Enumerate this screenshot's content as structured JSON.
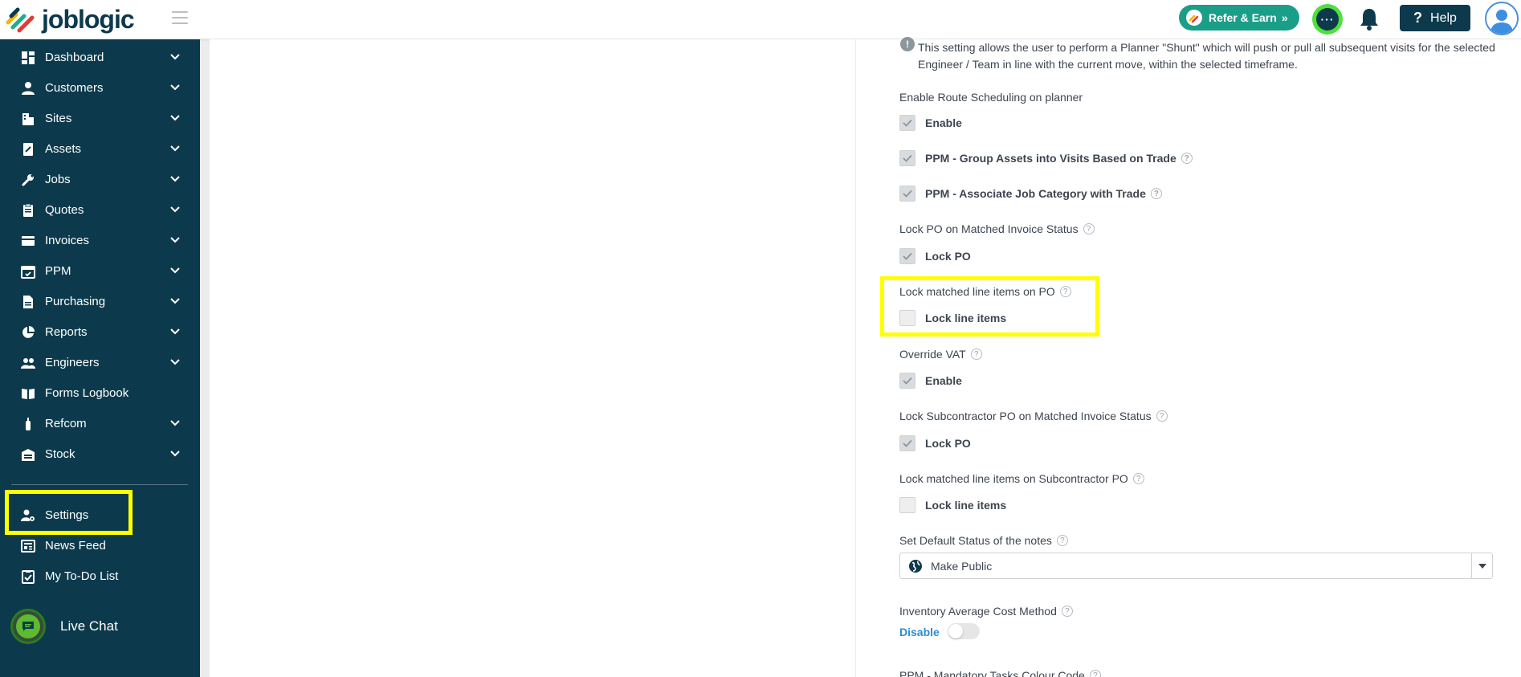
{
  "header": {
    "logo_text": "joblogic",
    "refer_button": "Refer & Earn",
    "help_button": "Help"
  },
  "sidebar": {
    "items": [
      {
        "label": "Dashboard",
        "icon": "dashboard-icon",
        "has_chevron": true
      },
      {
        "label": "Customers",
        "icon": "person-icon",
        "has_chevron": true
      },
      {
        "label": "Sites",
        "icon": "building-icon",
        "has_chevron": true
      },
      {
        "label": "Assets",
        "icon": "asset-icon",
        "has_chevron": true
      },
      {
        "label": "Jobs",
        "icon": "wrench-icon",
        "has_chevron": true
      },
      {
        "label": "Quotes",
        "icon": "clipboard-icon",
        "has_chevron": true
      },
      {
        "label": "Invoices",
        "icon": "card-icon",
        "has_chevron": true
      },
      {
        "label": "PPM",
        "icon": "calendar-icon",
        "has_chevron": true
      },
      {
        "label": "Purchasing",
        "icon": "document-icon",
        "has_chevron": true
      },
      {
        "label": "Reports",
        "icon": "pie-chart-icon",
        "has_chevron": true
      },
      {
        "label": "Engineers",
        "icon": "people-icon",
        "has_chevron": true
      },
      {
        "label": "Forms Logbook",
        "icon": "book-icon",
        "has_chevron": false
      },
      {
        "label": "Refcom",
        "icon": "cylinder-icon",
        "has_chevron": true
      },
      {
        "label": "Stock",
        "icon": "warehouse-icon",
        "has_chevron": true
      }
    ],
    "bottom_items": [
      {
        "label": "Settings",
        "icon": "user-settings-icon"
      },
      {
        "label": "News Feed",
        "icon": "newspaper-icon"
      },
      {
        "label": "My To-Do List",
        "icon": "checklist-icon"
      }
    ],
    "live_chat": "Live Chat"
  },
  "settings": {
    "shunt_description": "This setting allows the user to perform a Planner \"Shunt\" which will push or pull all subsequent visits for the selected Engineer / Team in line with the current move, within the selected timeframe.",
    "route_title": "Enable Route Scheduling on planner",
    "route_enable": "Enable",
    "ppm_group_assets": "PPM - Group Assets into Visits Based on Trade",
    "ppm_associate": "PPM - Associate Job Category with Trade",
    "lock_po_title": "Lock PO on Matched Invoice Status",
    "lock_po": "Lock PO",
    "lock_lines_title": "Lock matched line items on PO",
    "lock_lines": "Lock line items",
    "override_vat_title": "Override VAT",
    "override_vat_enable": "Enable",
    "lock_sub_po_title": "Lock Subcontractor PO on Matched Invoice Status",
    "lock_sub_po": "Lock PO",
    "lock_sub_lines_title": "Lock matched line items on Subcontractor PO",
    "lock_sub_lines": "Lock line items",
    "notes_status_title": "Set Default Status of the notes",
    "notes_status_value": "Make Public",
    "inventory_title": "Inventory Average Cost Method",
    "inventory_toggle_label": "Disable",
    "next_title": "PPM - Mandatory Tasks Colour Code"
  },
  "colors": {
    "sidebar": "#0c3a4c",
    "highlight": "#ffff00",
    "refer": "#1b9e88",
    "link": "#2d8cd4"
  }
}
